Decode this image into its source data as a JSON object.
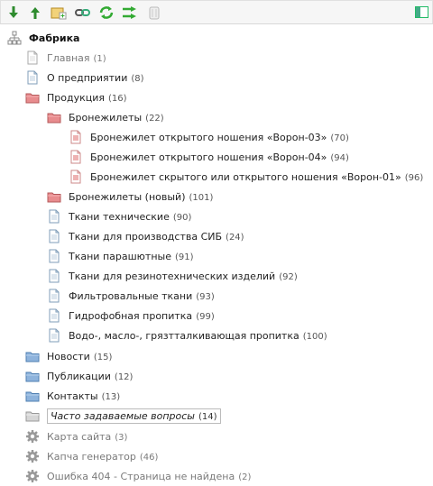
{
  "toolbar": {
    "buttons": [
      {
        "name": "move-down-button",
        "icon": "arrow-down-icon"
      },
      {
        "name": "move-up-button",
        "icon": "arrow-up-icon"
      },
      {
        "name": "add-folder-button",
        "icon": "folder-add-icon"
      },
      {
        "name": "link-button",
        "icon": "link-icon"
      },
      {
        "name": "refresh-button",
        "icon": "refresh-icon"
      },
      {
        "name": "redirect-button",
        "icon": "redirect-icon"
      },
      {
        "name": "delete-button",
        "icon": "trash-icon"
      }
    ],
    "right_button": {
      "name": "expand-view-button",
      "icon": "panel-icon"
    }
  },
  "tree": {
    "root": {
      "label": "Фабрика",
      "icon": "sitemap-icon"
    },
    "items": [
      {
        "label": "Главная",
        "count": "(1)",
        "icon": "page-gray-icon",
        "state": "dim"
      },
      {
        "label": "О предприятии",
        "count": "(8)",
        "icon": "page-icon"
      },
      {
        "label": "Продукция",
        "count": "(16)",
        "icon": "folder-red-icon"
      },
      {
        "label": "Бронежилеты",
        "count": "(22)",
        "icon": "folder-red-icon"
      },
      {
        "label": "Бронежилет открытого ношения «Ворон-03»",
        "count": "(70)",
        "icon": "page-red-icon"
      },
      {
        "label": "Бронежилет открытого ношения «Ворон-04»",
        "count": "(94)",
        "icon": "page-red-icon"
      },
      {
        "label": "Бронежилет скрытого или открытого ношения «Ворон-01»",
        "count": "(96)",
        "icon": "page-red-icon"
      },
      {
        "label": "Бронежилеты (новый)",
        "count": "(101)",
        "icon": "folder-red-icon"
      },
      {
        "label": "Ткани технические",
        "count": "(90)",
        "icon": "page-icon"
      },
      {
        "label": "Ткани для производства СИБ",
        "count": "(24)",
        "icon": "page-icon"
      },
      {
        "label": "Ткани парашютные",
        "count": "(91)",
        "icon": "page-icon"
      },
      {
        "label": "Ткани для резинотехнических изделий",
        "count": "(92)",
        "icon": "page-icon"
      },
      {
        "label": "Фильтровальные ткани",
        "count": "(93)",
        "icon": "page-icon"
      },
      {
        "label": "Гидрофобная пропитка",
        "count": "(99)",
        "icon": "page-icon"
      },
      {
        "label": "Водо-, масло-, грязтталкивающая пропитка",
        "count": "(100)",
        "icon": "page-icon"
      },
      {
        "label": "Новости",
        "count": "(15)",
        "icon": "folder-blue-icon"
      },
      {
        "label": "Публикации",
        "count": "(12)",
        "icon": "folder-blue-icon"
      },
      {
        "label": "Контакты",
        "count": "(13)",
        "icon": "folder-blue-icon"
      },
      {
        "label": "Часто задаваемые вопросы",
        "count": "(14)",
        "icon": "folder-gray-icon",
        "state": "italic"
      },
      {
        "label": "Карта сайта",
        "count": "(3)",
        "icon": "gear-icon",
        "state": "dim"
      },
      {
        "label": "Капча генератор",
        "count": "(46)",
        "icon": "gear-icon",
        "state": "dim"
      },
      {
        "label": "Ошибка 404 - Страница не найдена",
        "count": "(2)",
        "icon": "gear-icon",
        "state": "dim"
      }
    ]
  },
  "colors": {
    "folder_red": "#e0787a",
    "folder_blue": "#7aa6d6",
    "page_border": "#7f9db9",
    "page_red_mark": "#c33"
  }
}
